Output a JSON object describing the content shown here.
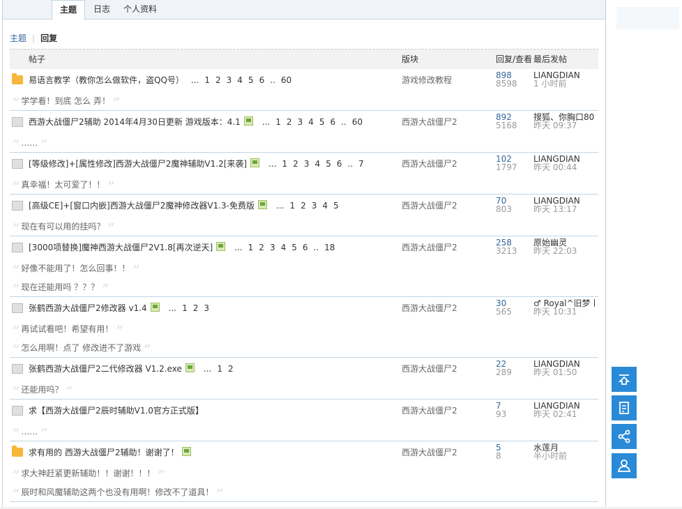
{
  "tabs": [
    "主题",
    "日志",
    "个人资料"
  ],
  "subnav": {
    "link": "主题",
    "current": "回复"
  },
  "table_headers": {
    "topic": "帖子",
    "forum": "版块",
    "stats": "回复/查看",
    "last": "最后发帖"
  },
  "rows": [
    {
      "icon": "hot",
      "title": "易语言教学（教你怎么做软件，盗QQ号）",
      "attach": false,
      "pages": [
        "...",
        "1",
        "2",
        "3",
        "4",
        "5",
        "6",
        "..",
        "60"
      ],
      "forum": "游戏修改教程",
      "replies": "898",
      "views": "8598",
      "author": "LIANGDIAN",
      "time": "1 小时前",
      "quotes": [
        "学学看！到底 怎么 弄！"
      ]
    },
    {
      "icon": "normal",
      "title": "西游大战僵尸2辅助 2014年4月30日更新 游戏版本：4.1",
      "attach": true,
      "pages": [
        "...",
        "1",
        "2",
        "3",
        "4",
        "5",
        "6",
        "..",
        "60"
      ],
      "forum": "西游大战僵尸2",
      "replies": "892",
      "views": "5168",
      "author": "搜狐、你胸口80",
      "time": "昨天 09:37",
      "quotes": [
        "……"
      ]
    },
    {
      "icon": "normal",
      "title": "[等级修改]+[属性修改]西游大战僵尸2魔神辅助V1.2[来袭]",
      "attach": true,
      "pages": [
        "...",
        "1",
        "2",
        "3",
        "4",
        "5",
        "6",
        "..",
        "7"
      ],
      "forum": "西游大战僵尸2",
      "replies": "102",
      "views": "1797",
      "author": "LIANGDIAN",
      "time": "昨天 00:44",
      "quotes": [
        "真幸福！太可爱了！！"
      ]
    },
    {
      "icon": "normal",
      "title": "[高级CE]+[窗口内嵌]西游大战僵尸2魔神修改器V1.3-免费版",
      "attach": true,
      "pages": [
        "...",
        "1",
        "2",
        "3",
        "4",
        "5"
      ],
      "forum": "西游大战僵尸2",
      "replies": "70",
      "views": "803",
      "author": "LIANGDIAN",
      "time": "昨天 13:17",
      "quotes": [
        "现在有可以用的挂吗？"
      ]
    },
    {
      "icon": "normal",
      "title": "[3000项替换]魔神西游大战僵尸2V1.8[再次逆天]",
      "attach": true,
      "pages": [
        "...",
        "1",
        "2",
        "3",
        "4",
        "5",
        "6",
        "..",
        "18"
      ],
      "forum": "西游大战僵尸2",
      "replies": "258",
      "views": "3213",
      "author": "原始幽灵",
      "time": "昨天 22:03",
      "quotes": [
        "好像不能用了！怎么回事！！",
        "现在还能用吗 ？？？"
      ]
    },
    {
      "icon": "normal",
      "title": "张鹤西游大战僵尸2修改器 v1.4",
      "attach": true,
      "pages": [
        "...",
        "1",
        "2",
        "3"
      ],
      "forum": "西游大战僵尸2",
      "replies": "30",
      "views": "565",
      "author": "♂ Royal^旧梦丨",
      "time": "昨天 10:31",
      "quotes": [
        "再试试看吧！希望有用！",
        "怎么用啊！点了 修改进不了游戏"
      ]
    },
    {
      "icon": "normal",
      "title": "张鹤西游大战僵尸2二代修改器 V1.2.exe",
      "attach": true,
      "pages": [
        "...",
        "1",
        "2"
      ],
      "forum": "西游大战僵尸2",
      "replies": "22",
      "views": "289",
      "author": "LIANGDIAN",
      "time": "昨天 01:50",
      "quotes": [
        "还能用吗？"
      ]
    },
    {
      "icon": "normal",
      "title": "求【西游大战僵尸2辰时辅助V1.0官方正式版】",
      "attach": false,
      "pages": [],
      "forum": "西游大战僵尸2",
      "replies": "7",
      "views": "93",
      "author": "LIANGDIAN",
      "time": "昨天 02:41",
      "quotes": [
        "……"
      ]
    },
    {
      "icon": "hot",
      "title": "求有用的 西游大战僵尸2辅助！谢谢了！",
      "attach": true,
      "pages": [],
      "forum": "西游大战僵尸2",
      "replies": "5",
      "views": "8",
      "author": "水莲月",
      "time": "半小时前",
      "quotes": [
        "求大神赶紧更新辅助！！谢谢！！！",
        "辰时和风魔辅助这两个也没有用啊！修改不了道具！"
      ]
    }
  ],
  "side_buttons": [
    "back-to-top-icon",
    "reply-icon",
    "share-icon",
    "user-icon"
  ],
  "colors": {
    "accent": "#2a8ad8",
    "link": "#336699",
    "border": "#c2d5e3"
  }
}
